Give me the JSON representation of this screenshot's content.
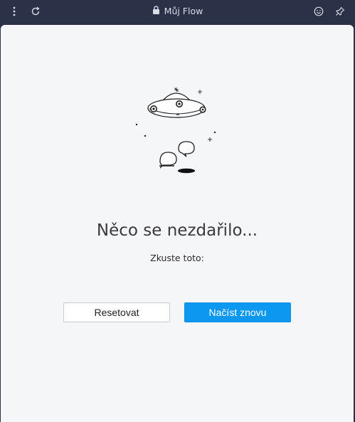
{
  "window": {
    "title": "Můj Flow"
  },
  "error": {
    "heading": "Něco se nezdařilo...",
    "subtext": "Zkuste toto:"
  },
  "actions": {
    "reset_label": "Resetovat",
    "reload_label": "Načíst znovu"
  },
  "colors": {
    "titlebar": "#2b3147",
    "content_bg": "#f5f6f8",
    "primary_button": "#0c98f0"
  },
  "icons": {
    "menu": "more-vertical-icon",
    "reload": "refresh-icon",
    "lock": "lock-icon",
    "emoji": "smiley-icon",
    "pin": "pin-icon",
    "illustration": "ufo-illustration"
  }
}
